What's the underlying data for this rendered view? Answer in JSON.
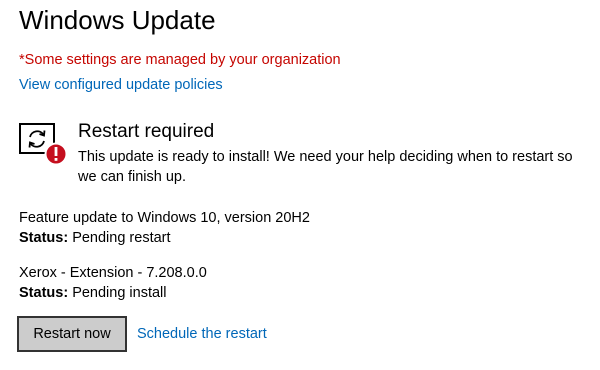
{
  "page": {
    "title": "Windows Update"
  },
  "notice": {
    "managed_text": "*Some settings are managed by your organization",
    "color": "#c50500"
  },
  "links": {
    "policies": "View configured update policies",
    "schedule": "Schedule the restart",
    "color": "#0067b8"
  },
  "status": {
    "icon": "restart-required-icon",
    "heading": "Restart required",
    "message": "This update is ready to install! We need your help deciding when to restart so we can finish up."
  },
  "updates": [
    {
      "name": "Feature update to Windows 10, version 20H2",
      "status_label": "Status:",
      "status_value": "Pending restart"
    },
    {
      "name": "Xerox - Extension - 7.208.0.0",
      "status_label": "Status:",
      "status_value": "Pending install"
    }
  ],
  "actions": {
    "restart_label": "Restart now"
  }
}
